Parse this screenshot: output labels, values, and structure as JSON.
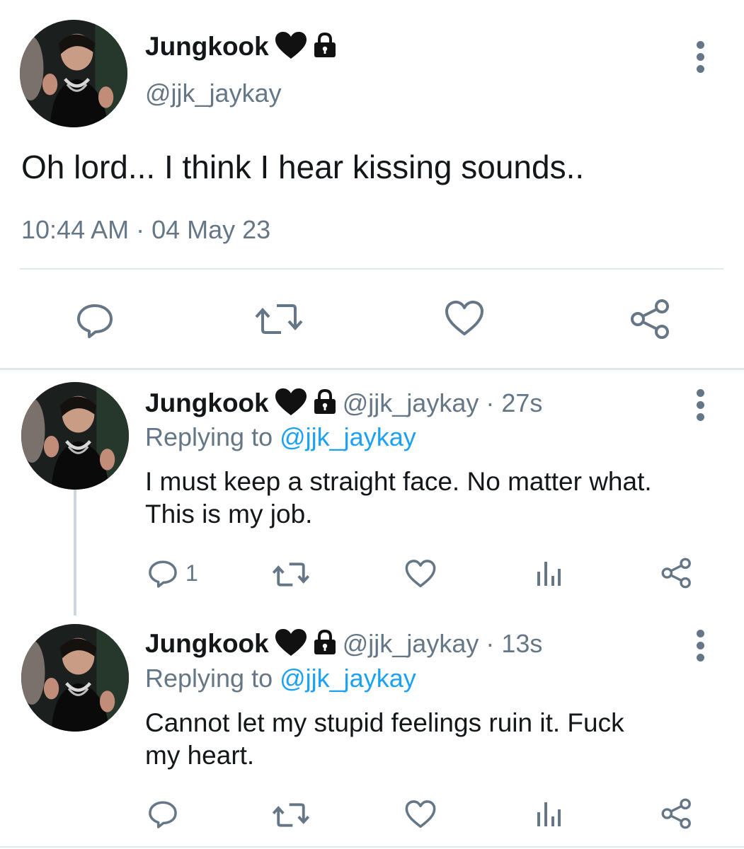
{
  "main_tweet": {
    "display_name": "Jungkook",
    "handle": "@jjk_jaykay",
    "text": "Oh lord... I think I hear kissing sounds..",
    "timestamp": "10:44 AM · 04 May 23"
  },
  "replies": [
    {
      "display_name": "Jungkook",
      "handle_time": "@jjk_jaykay · 27s",
      "replying_prefix": "Replying to ",
      "replying_handle": "@jjk_jaykay",
      "text_line1": "I must keep a straight face. No matter what.",
      "text_line2": "This is my job.",
      "reply_count": "1"
    },
    {
      "display_name": "Jungkook",
      "handle_time": "@jjk_jaykay · 13s",
      "replying_prefix": "Replying to ",
      "replying_handle": "@jjk_jaykay",
      "text_line1": "Cannot let my stupid feelings ruin it. Fuck",
      "text_line2": "my heart.",
      "reply_count": ""
    }
  ],
  "icons": {
    "more": "more-vertical-icon",
    "reply": "reply-icon",
    "retweet": "retweet-icon",
    "like": "like-icon",
    "share": "share-icon",
    "analytics": "analytics-icon",
    "verified_heart": "black-heart-icon",
    "protected": "lock-icon"
  },
  "colors": {
    "text": "#14171a",
    "muted": "#657786",
    "link": "#1da1f2",
    "divider": "#e1e8ed"
  }
}
